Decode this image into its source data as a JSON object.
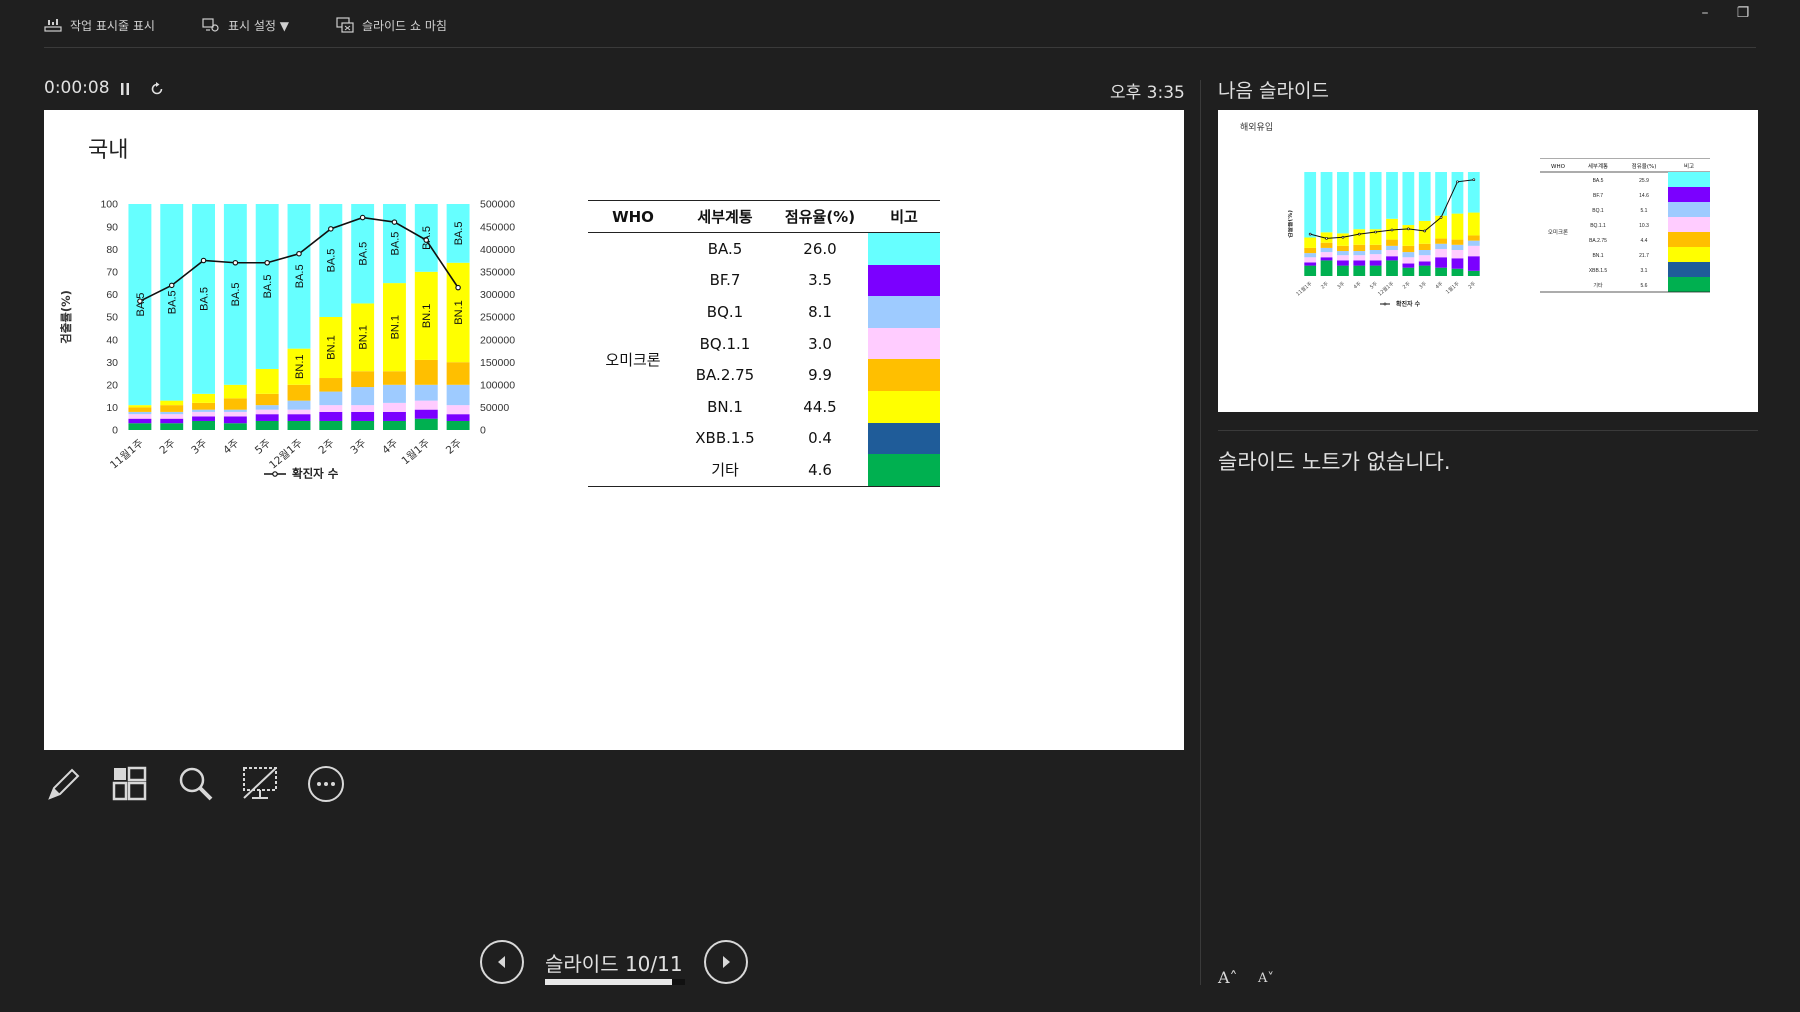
{
  "toolbar": {
    "show_taskbar": "작업 표시줄 표시",
    "display_settings": "표시 설정 ▼",
    "end_show": "슬라이드 쇼 마침"
  },
  "window": {
    "minimize": "–",
    "restore": "❐"
  },
  "presenter": {
    "timer": "0:00:08",
    "clock": "오후 3:35",
    "pause_icon": "pause-icon",
    "reset_icon": "reset-icon"
  },
  "slide": {
    "title": "국내",
    "chart_data": {
      "type": "bar",
      "stacked": true,
      "categories": [
        "11월1주",
        "2주",
        "3주",
        "4주",
        "5주",
        "12월1주",
        "2주",
        "3주",
        "4주",
        "1월1주",
        "2주"
      ],
      "ylabel": "검출률(%)",
      "ylim": [
        0,
        100
      ],
      "y_ticks": [
        0,
        10,
        20,
        30,
        40,
        50,
        60,
        70,
        80,
        90,
        100
      ],
      "y2_ticks": [
        "0",
        "50000",
        "100000",
        "150000",
        "200000",
        "250000",
        "300000",
        "350000",
        "400000",
        "450000",
        "500000"
      ],
      "y2lim": [
        0,
        500000
      ],
      "legend": "확진자 수",
      "legend_position": "bottom",
      "grid": false,
      "series": [
        {
          "name": "기타",
          "color": "#00b050",
          "values": [
            3,
            3,
            4,
            3,
            4,
            4,
            4,
            4,
            4,
            5,
            4
          ]
        },
        {
          "name": "XBB.1.5",
          "color": "#1f5c99",
          "values": [
            0,
            0,
            0,
            0,
            0,
            0,
            0,
            0,
            0,
            0,
            0
          ]
        },
        {
          "name": "BF.7",
          "color": "#7b00ff",
          "values": [
            2,
            2,
            2,
            3,
            3,
            3,
            4,
            4,
            4,
            4,
            3
          ]
        },
        {
          "name": "BQ.1.1",
          "color": "#ffccff",
          "values": [
            2,
            2,
            2,
            2,
            2,
            2,
            3,
            3,
            4,
            4,
            4
          ]
        },
        {
          "name": "BQ.1",
          "color": "#9ecbff",
          "values": [
            1,
            1,
            1,
            1,
            2,
            4,
            6,
            8,
            8,
            7,
            9
          ]
        },
        {
          "name": "BA.2.75",
          "color": "#ffbf00",
          "values": [
            2,
            3,
            3,
            5,
            5,
            7,
            6,
            7,
            6,
            11,
            10
          ]
        },
        {
          "name": "BN.1",
          "color": "#ffff00",
          "values": [
            1,
            2,
            4,
            6,
            11,
            16,
            27,
            30,
            39,
            39,
            44
          ]
        },
        {
          "name": "BA.5",
          "color": "#66ffff",
          "values": [
            89,
            87,
            84,
            80,
            73,
            64,
            50,
            44,
            35,
            30,
            26
          ]
        }
      ],
      "bar_labels": [
        [
          {
            "text": "BA.5",
            "series": "BA.5"
          }
        ],
        [
          {
            "text": "BA.5",
            "series": "BA.5"
          }
        ],
        [
          {
            "text": "BA.5",
            "series": "BA.5"
          }
        ],
        [
          {
            "text": "BA.5",
            "series": "BA.5"
          }
        ],
        [
          {
            "text": "BA.5",
            "series": "BA.5"
          }
        ],
        [
          {
            "text": "BA.5",
            "series": "BA.5"
          },
          {
            "text": "BN.1",
            "series": "BN.1"
          }
        ],
        [
          {
            "text": "BA.5",
            "series": "BA.5"
          },
          {
            "text": "BN.1",
            "series": "BN.1"
          }
        ],
        [
          {
            "text": "BA.5",
            "series": "BA.5"
          },
          {
            "text": "BN.1",
            "series": "BN.1"
          }
        ],
        [
          {
            "text": "BA.5",
            "series": "BA.5"
          },
          {
            "text": "BN.1",
            "series": "BN.1"
          }
        ],
        [
          {
            "text": "BA.5",
            "series": "BA.5"
          },
          {
            "text": "BN.1",
            "series": "BN.1"
          }
        ],
        [
          {
            "text": "BA.5",
            "series": "BA.5"
          },
          {
            "text": "BN.1",
            "series": "BN.1"
          }
        ]
      ],
      "line_series": {
        "name": "확진자 수",
        "values": [
          285000,
          320000,
          375000,
          370000,
          370000,
          390000,
          445000,
          470000,
          460000,
          420000,
          315000
        ]
      }
    },
    "table": {
      "headers": [
        "WHO",
        "세부계통",
        "점유율(%)",
        "비고"
      ],
      "who_value": "오미크론",
      "rows": [
        {
          "lineage": "BA.5",
          "share": "26.0",
          "color": "#66ffff"
        },
        {
          "lineage": "BF.7",
          "share": "3.5",
          "color": "#7b00ff"
        },
        {
          "lineage": "BQ.1",
          "share": "8.1",
          "color": "#9ecbff"
        },
        {
          "lineage": "BQ.1.1",
          "share": "3.0",
          "color": "#ffccff"
        },
        {
          "lineage": "BA.2.75",
          "share": "9.9",
          "color": "#ffbf00"
        },
        {
          "lineage": "BN.1",
          "share": "44.5",
          "color": "#ffff00"
        },
        {
          "lineage": "XBB.1.5",
          "share": "0.4",
          "color": "#1f5c99"
        },
        {
          "lineage": "기타",
          "share": "4.6",
          "color": "#00b050"
        }
      ]
    }
  },
  "tools": [
    "pen-icon",
    "all-slides-icon",
    "zoom-icon",
    "black-screen-icon",
    "more-icon"
  ],
  "navigation": {
    "counter": "슬라이드 10/11",
    "progress": 0.91
  },
  "next_slide": {
    "label": "나음 슬라이드",
    "title": "해외유입",
    "table": {
      "headers": [
        "WHO",
        "세부계통",
        "점유율(%)",
        "비고"
      ],
      "who_value": "오미크론",
      "rows": [
        {
          "lineage": "BA.5",
          "share": "25.9",
          "color": "#66ffff"
        },
        {
          "lineage": "BF.7",
          "share": "14.6",
          "color": "#7b00ff"
        },
        {
          "lineage": "BQ.1",
          "share": "5.1",
          "color": "#9ecbff"
        },
        {
          "lineage": "BQ.1.1",
          "share": "10.3",
          "color": "#ffccff"
        },
        {
          "lineage": "BA.2.75",
          "share": "4.4",
          "color": "#ffbf00"
        },
        {
          "lineage": "BN.1",
          "share": "21.7",
          "color": "#ffff00"
        },
        {
          "lineage": "XBB.1.5",
          "share": "3.1",
          "color": "#1f5c99"
        },
        {
          "lineage": "기타",
          "share": "5.6",
          "color": "#00b050"
        }
      ]
    },
    "chart_data": {
      "type": "bar",
      "stacked": true,
      "categories": [
        "11월1주",
        "2주",
        "3주",
        "4주",
        "5주",
        "12월1주",
        "2주",
        "3주",
        "4주",
        "1월1주",
        "2주"
      ],
      "ylabel": "검출률(%)",
      "legend": "확진자 수",
      "series": [
        {
          "name": "기타",
          "color": "#00b050",
          "values": [
            10,
            15,
            10,
            10,
            10,
            15,
            8,
            10,
            8,
            7,
            5
          ]
        },
        {
          "name": "BF.7",
          "color": "#7b00ff",
          "values": [
            3,
            3,
            5,
            5,
            5,
            4,
            4,
            4,
            10,
            10,
            14
          ]
        },
        {
          "name": "BQ.1.1",
          "color": "#ffccff",
          "values": [
            5,
            5,
            5,
            5,
            6,
            6,
            6,
            6,
            8,
            8,
            10
          ]
        },
        {
          "name": "BQ.1",
          "color": "#9ecbff",
          "values": [
            4,
            4,
            4,
            4,
            4,
            4,
            5,
            5,
            5,
            5,
            5
          ]
        },
        {
          "name": "BA.2.75",
          "color": "#ffbf00",
          "values": [
            5,
            5,
            5,
            6,
            5,
            6,
            6,
            6,
            5,
            5,
            5
          ]
        },
        {
          "name": "BN.1",
          "color": "#ffff00",
          "values": [
            10,
            10,
            12,
            15,
            15,
            20,
            20,
            22,
            22,
            25,
            22
          ]
        },
        {
          "name": "BA.5",
          "color": "#66ffff",
          "values": [
            63,
            58,
            59,
            55,
            55,
            45,
            51,
            47,
            42,
            40,
            39
          ]
        }
      ],
      "line_series": {
        "name": "확진자 수",
        "values": [
          400,
          360,
          370,
          400,
          420,
          440,
          450,
          430,
          560,
          900,
          920
        ]
      }
    }
  },
  "notes": {
    "text": "슬라이드 노트가 없습니다."
  },
  "font_controls": {
    "increase": "A˄",
    "decrease": "A˅"
  }
}
